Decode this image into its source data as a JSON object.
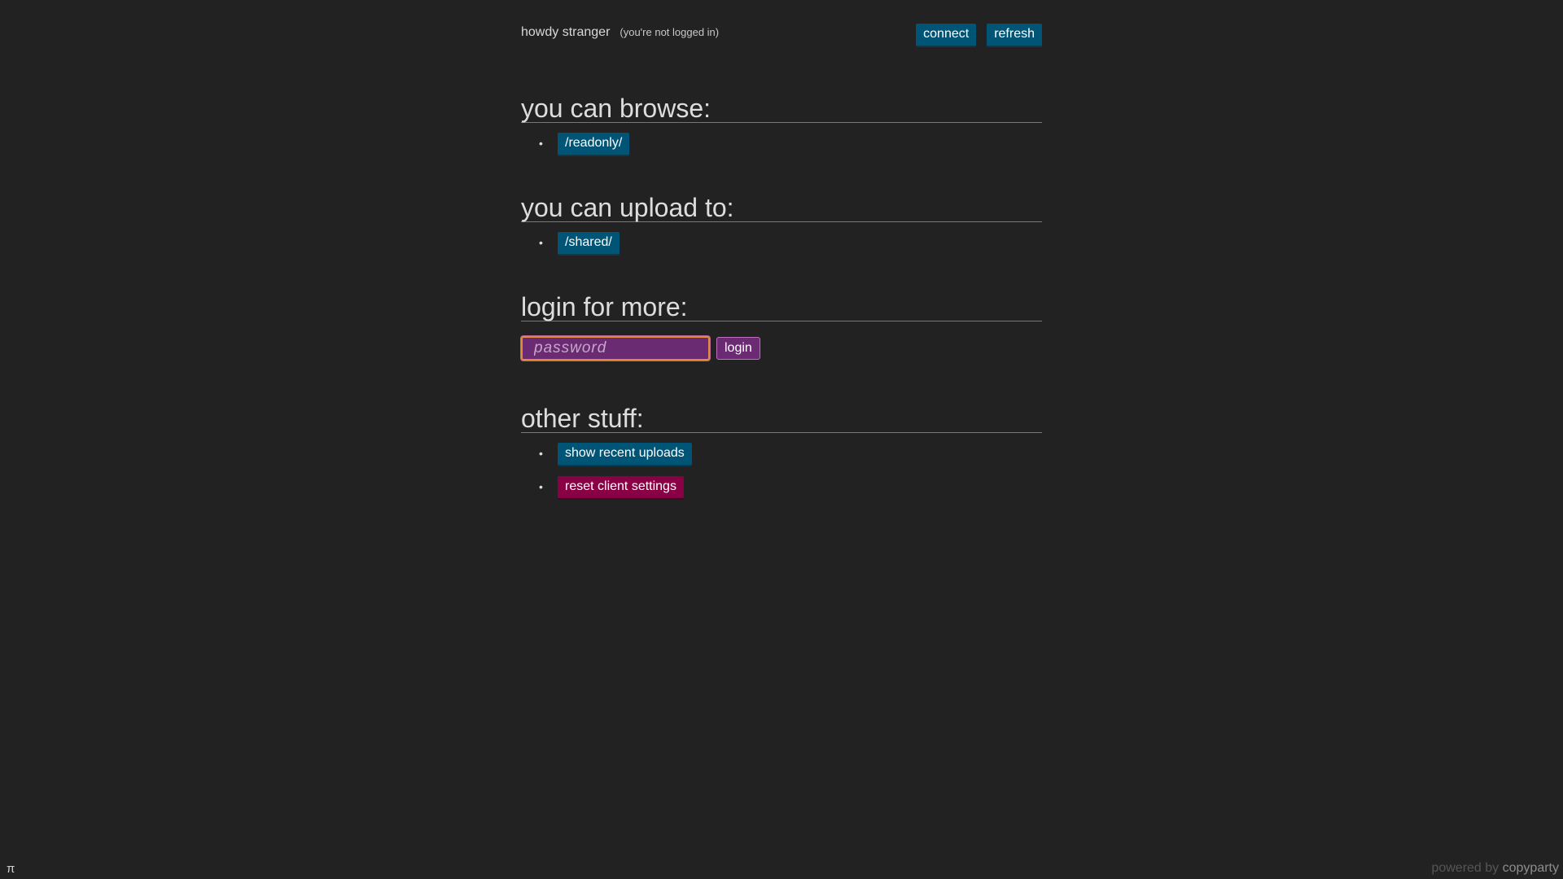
{
  "header": {
    "greeting": "howdy stranger",
    "status": "(you're not logged in)",
    "connect_label": "connect",
    "refresh_label": "refresh"
  },
  "browse": {
    "heading": "you can browse:",
    "items": [
      {
        "label": "/readonly/"
      }
    ]
  },
  "upload": {
    "heading": "you can upload to:",
    "items": [
      {
        "label": "/shared/"
      }
    ]
  },
  "login": {
    "heading": "login for more:",
    "password_placeholder": "password",
    "password_value": "",
    "button_label": "login",
    "accent_color": "#6a2b72"
  },
  "other": {
    "heading": "other stuff:",
    "recent_uploads_label": "show recent uploads",
    "reset_settings_label": "reset client settings"
  },
  "footer": {
    "pi_symbol": "π",
    "powered_by": "powered by",
    "brand": "copyparty"
  },
  "colors": {
    "background": "#222222",
    "button_blue": "#005577",
    "button_red": "#8a0044"
  }
}
